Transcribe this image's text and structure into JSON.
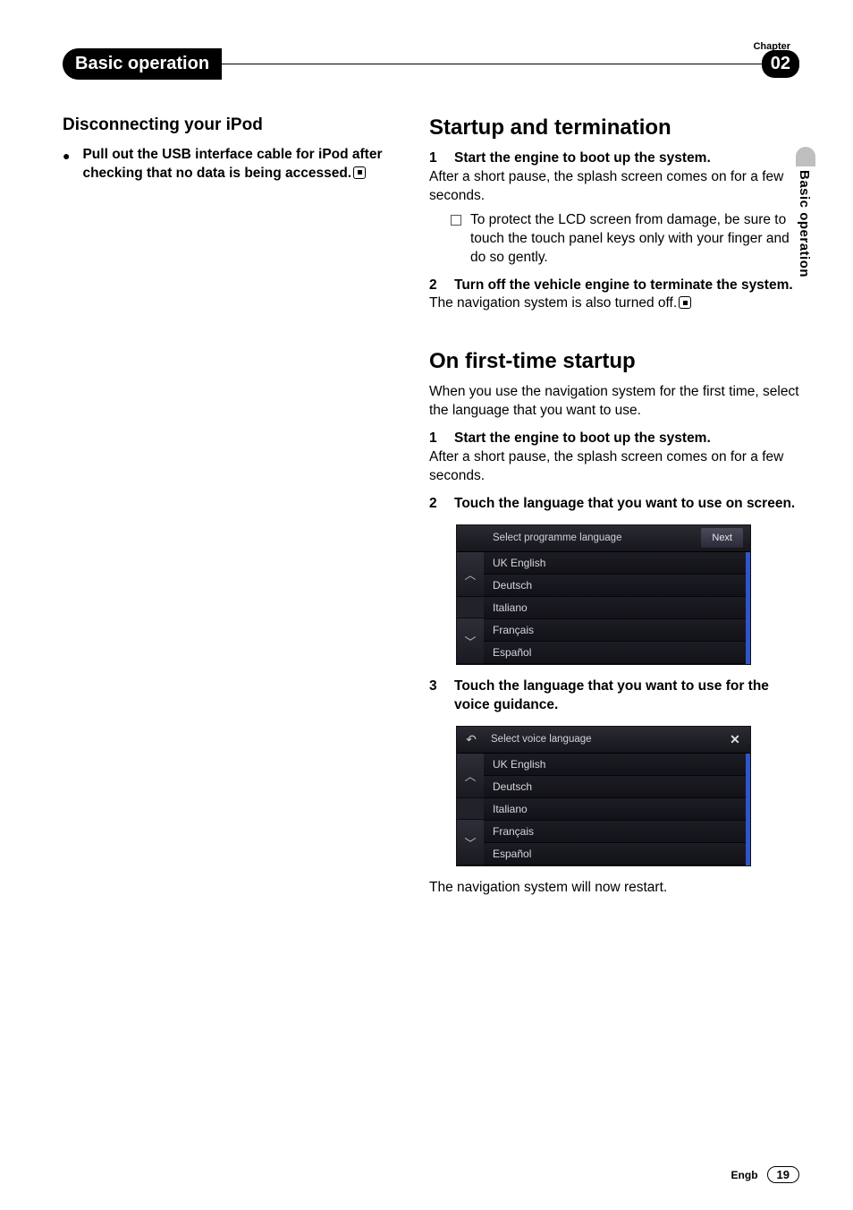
{
  "header": {
    "chapter_label": "Chapter",
    "section_title": "Basic operation",
    "chapter_number": "02"
  },
  "side_tab": "Basic operation",
  "left_column": {
    "heading": "Disconnecting your iPod",
    "bullet_text": "Pull out the USB interface cable for iPod after checking that no data is being accessed."
  },
  "right_column": {
    "section1": {
      "heading": "Startup and termination",
      "step1_bold": "Start the engine to boot up the system.",
      "step1_body": "After a short pause, the splash screen comes on for a few seconds.",
      "note": "To protect the LCD screen from damage, be sure to touch the touch panel keys only with your finger and do so gently.",
      "step2_bold": "Turn off the vehicle engine to terminate the system.",
      "step2_body": "The navigation system is also turned off."
    },
    "section2": {
      "heading": "On first-time startup",
      "intro": "When you use the navigation system for the first time, select the language that you want to use.",
      "step1_bold": "Start the engine to boot up the system.",
      "step1_body": "After a short pause, the splash screen comes on for a few seconds.",
      "step2_bold": "Touch the language that you want to use on screen.",
      "step3_bold": "Touch the language that you want to use for the voice guidance.",
      "closing": "The navigation system will now restart."
    }
  },
  "screenshot1": {
    "title": "Select programme language",
    "next": "Next",
    "items": [
      "UK English",
      "Deutsch",
      "Italiano",
      "Français",
      "Español"
    ]
  },
  "screenshot2": {
    "title": "Select voice language",
    "items": [
      "UK English",
      "Deutsch",
      "Italiano",
      "Français",
      "Español"
    ]
  },
  "footer": {
    "lang": "Engb",
    "page": "19"
  }
}
